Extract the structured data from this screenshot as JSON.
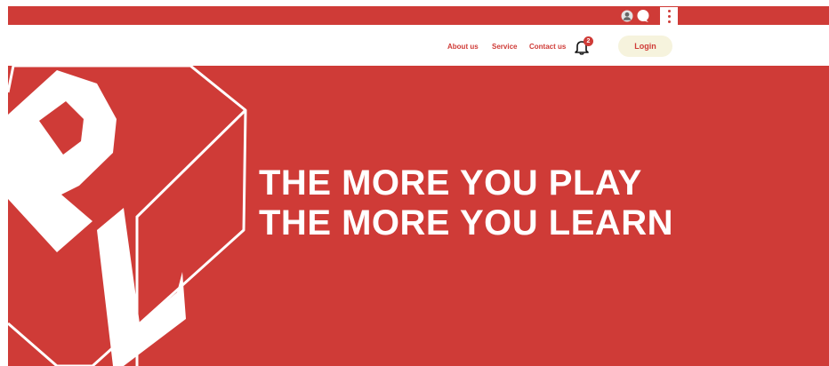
{
  "nav": {
    "links": [
      "About us",
      "Service",
      "Contact us"
    ],
    "notification_count": "2",
    "login_label": "Login"
  },
  "hero": {
    "line1": "THE MORE YOU PLAY",
    "line2": "THE MORE YOU LEARN",
    "logo_letters": "PL"
  },
  "icons": [
    "user-icon",
    "chat-icon",
    "kebab-menu-icon",
    "bell-icon"
  ],
  "colors": {
    "brand_red": "#cf3b37",
    "login_bg": "#f6f3dd",
    "white": "#ffffff"
  }
}
